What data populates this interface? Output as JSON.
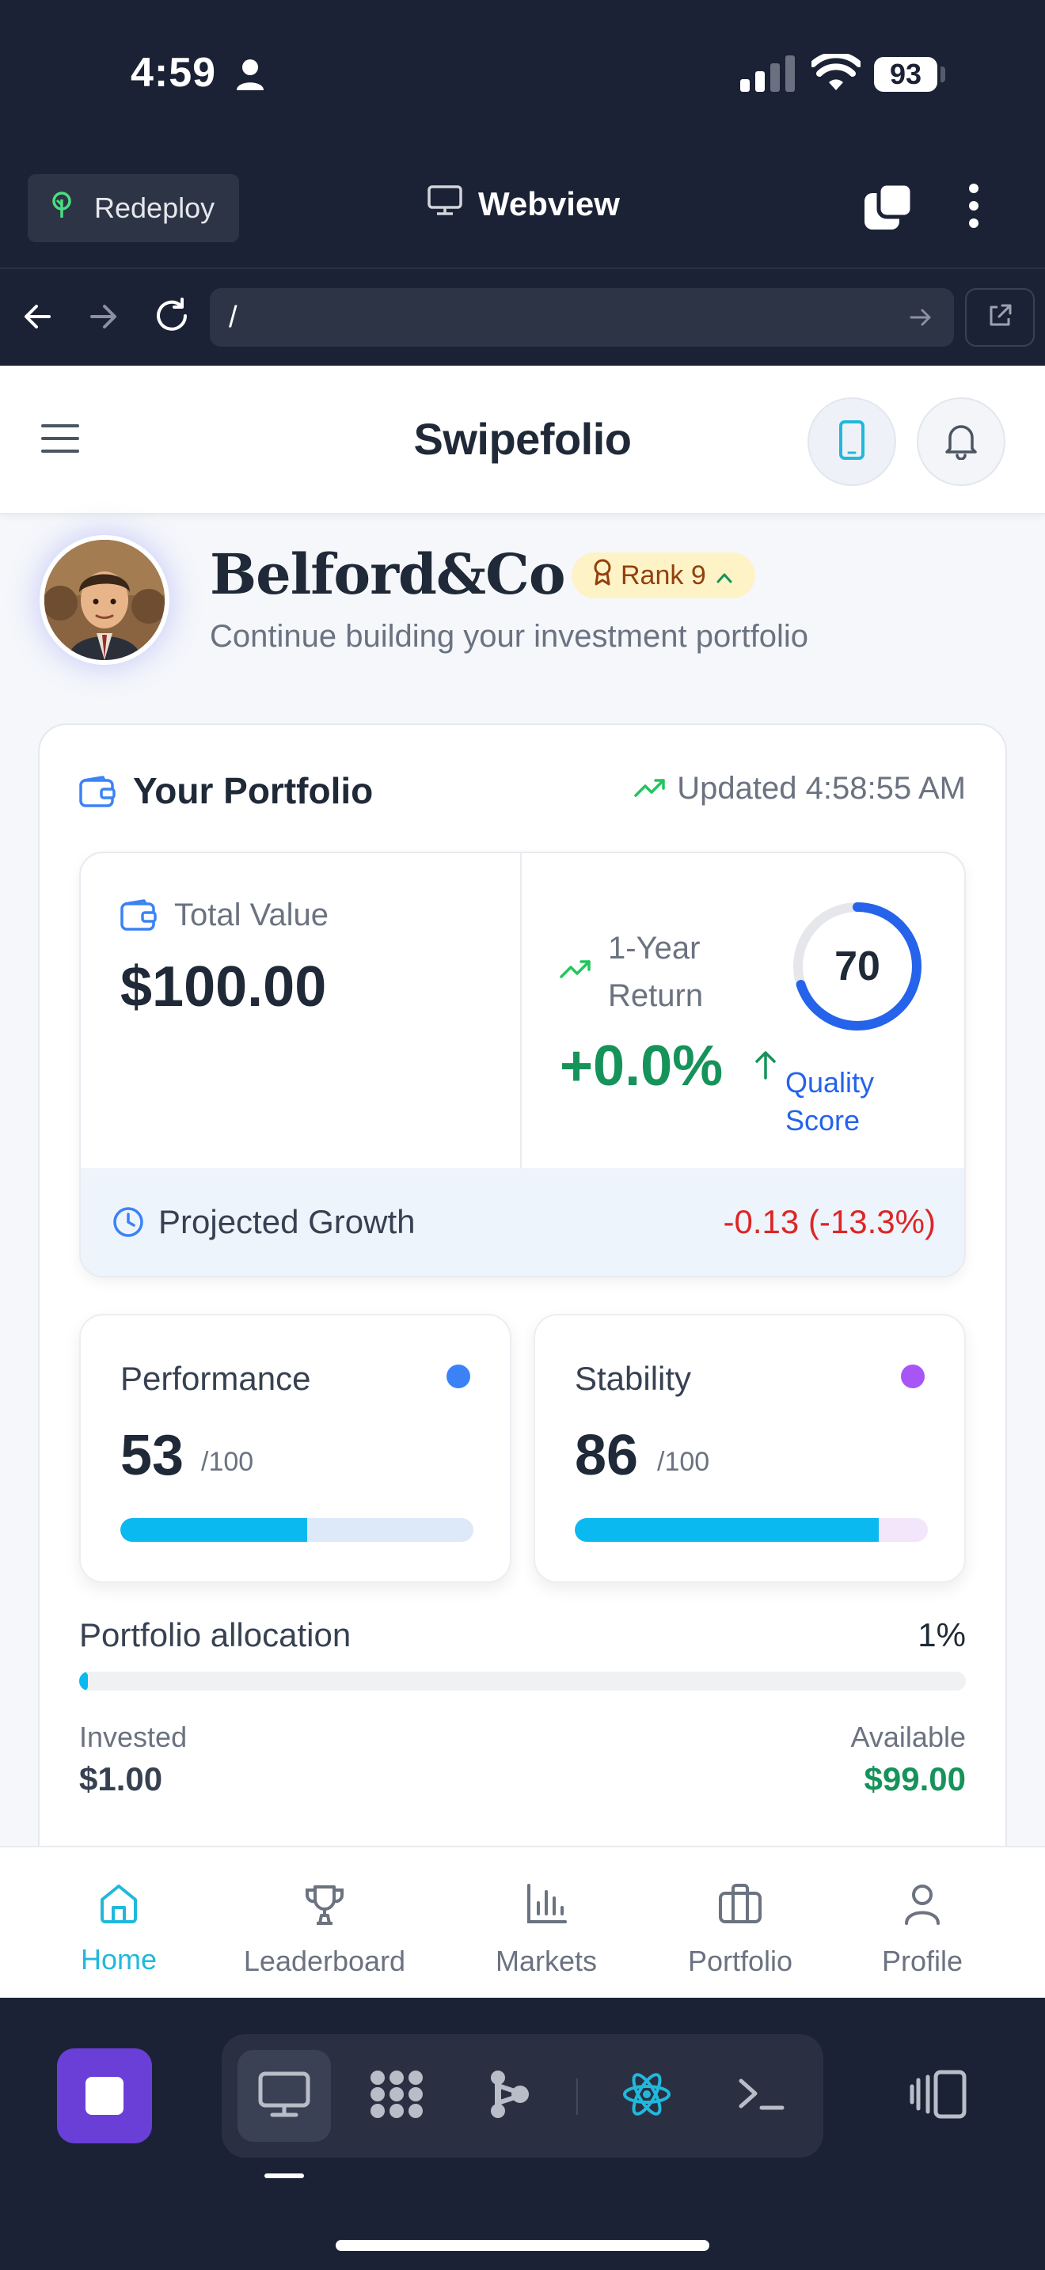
{
  "status_bar": {
    "time": "4:59",
    "battery": "93"
  },
  "dev_toolbar": {
    "redeploy_label": "Redeploy",
    "title": "Webview"
  },
  "url_bar": {
    "value": "/"
  },
  "app_header": {
    "brand": "Swipefolio"
  },
  "profile": {
    "name": "Belford&Co",
    "rank": "Rank 9",
    "subtitle": "Continue building your investment portfolio"
  },
  "portfolio": {
    "title": "Your Portfolio",
    "updated": "Updated 4:58:55 AM",
    "total_value_label": "Total Value",
    "total_value": "$100.00",
    "return_label": "1-Year Return",
    "return_value": "+0.0%",
    "quality_score": "70",
    "quality_score_fraction": 0.7,
    "quality_label": "Quality Score",
    "projected_label": "Projected Growth",
    "projected_value": "-0.13 (-13.3%)",
    "performance": {
      "label": "Performance",
      "value": "53",
      "max": "/100",
      "fraction": 0.53,
      "dot_color": "#3b82f6",
      "track_color": "#dde8f8"
    },
    "stability": {
      "label": "Stability",
      "value": "86",
      "max": "/100",
      "fraction": 0.86,
      "dot_color": "#a855f7",
      "track_color": "#f3e6fb"
    },
    "allocation_label": "Portfolio allocation",
    "allocation_pct": "1%",
    "allocation_fraction": 0.01,
    "invested_label": "Invested",
    "invested_value": "$1.00",
    "available_label": "Available",
    "available_value": "$99.00"
  },
  "bottom_nav": {
    "home": "Home",
    "leaderboard": "Leaderboard",
    "markets": "Markets",
    "portfolio": "Portfolio",
    "profile": "Profile"
  },
  "colors": {
    "accent": "#22b8dc",
    "positive": "#16935a",
    "negative": "#dc2626",
    "link": "#2563eb",
    "dock_stop": "#6a3fd8"
  },
  "icons": [
    "person-icon",
    "signal-icon",
    "wifi-icon",
    "tree-icon",
    "monitor-icon",
    "tabs-icon",
    "more-vertical-icon",
    "back-arrow-icon",
    "forward-arrow-icon",
    "reload-icon",
    "go-arrow-icon",
    "external-link-icon",
    "menu-icon",
    "phone-icon",
    "bell-icon",
    "award-icon",
    "chevron-up-icon",
    "wallet-icon",
    "trending-up-icon",
    "arrow-up-icon",
    "clock-icon",
    "home-icon",
    "trophy-icon",
    "bar-chart-icon",
    "briefcase-icon",
    "user-icon",
    "stop-icon",
    "desktop-icon",
    "grid-icon",
    "flow-icon",
    "react-icon",
    "terminal-icon",
    "split-view-icon"
  ]
}
